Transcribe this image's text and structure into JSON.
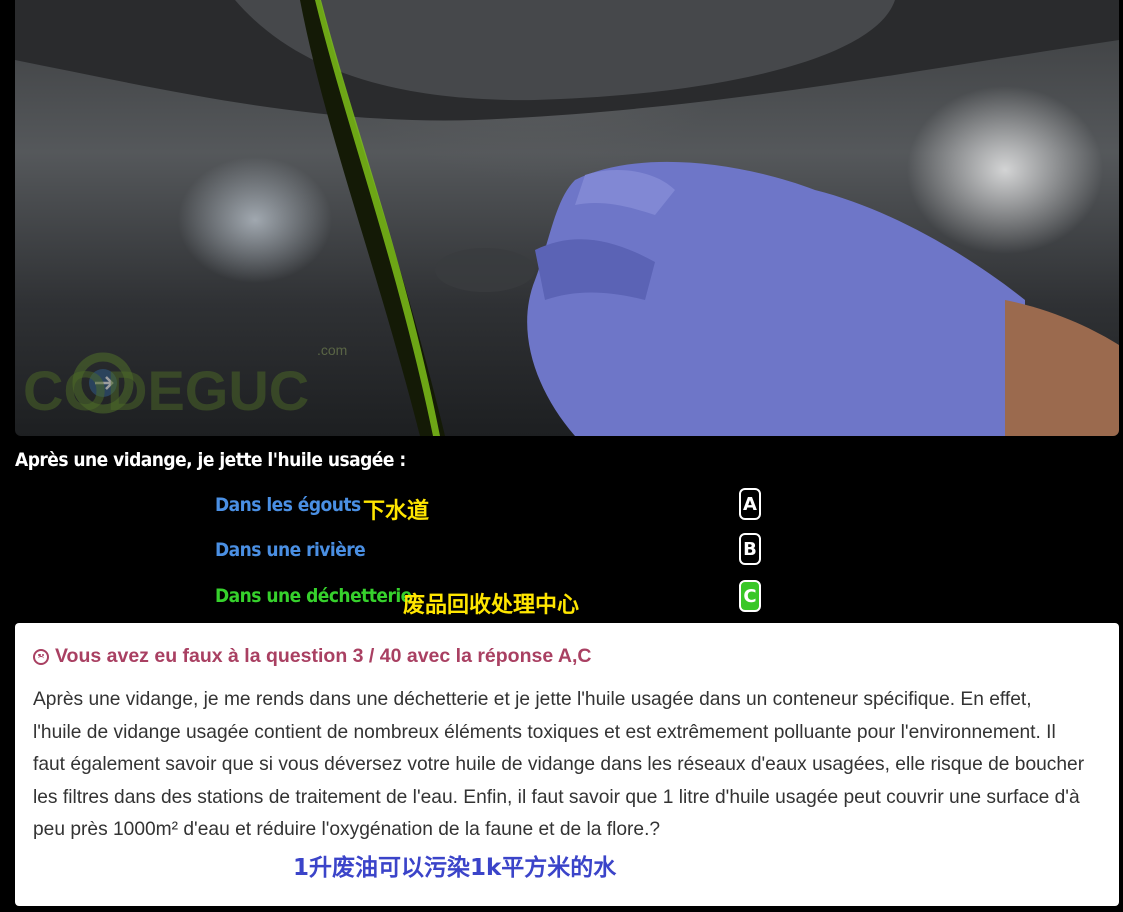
{
  "photo": {
    "watermark_text": "CODEGUC",
    "watermark_suffix": ".com"
  },
  "question": {
    "text": "Après une vidange, je jette l'huile usagée :"
  },
  "answers": [
    {
      "label": "Dans les égouts",
      "key": "A",
      "status": "blue",
      "note": "下水道"
    },
    {
      "label": "Dans une rivière",
      "key": "B",
      "status": "blue",
      "note": ""
    },
    {
      "label": "Dans une déchetterie",
      "key": "C",
      "status": "correct",
      "note": "废品回收处理中心"
    }
  ],
  "result": {
    "heading": "Vous avez eu faux à la question 3 / 40 avec la réponse A,C",
    "explanation": "Après une vidange, je me rends dans une déchetterie et je jette l'huile usagée dans un conteneur spécifique. En effet, l'huile de vidange usagée contient de nombreux éléments toxiques et est extrêmement polluante pour l'environnement. Il faut également savoir que si vous déversez votre huile de vidange dans les réseaux d'eaux usagées, elle risque de boucher les filtres dans des stations de traitement de l'eau. Enfin, il faut savoir que 1 litre d'huile usagée peut couvrir une surface d'à peu près 1000m² d'eau et réduire l'oxygénation de la faune et de la flore.?",
    "note": "1升废油可以污染1k平方米的水"
  },
  "colors": {
    "answer_blue": "#4a8fe3",
    "answer_green": "#36d12c",
    "note_yellow": "#ffe600",
    "note_blue": "#3b44c9",
    "heading": "#a94062",
    "correct_key": "#39c728"
  },
  "icons": {
    "result_icon": "sad-face-icon"
  }
}
